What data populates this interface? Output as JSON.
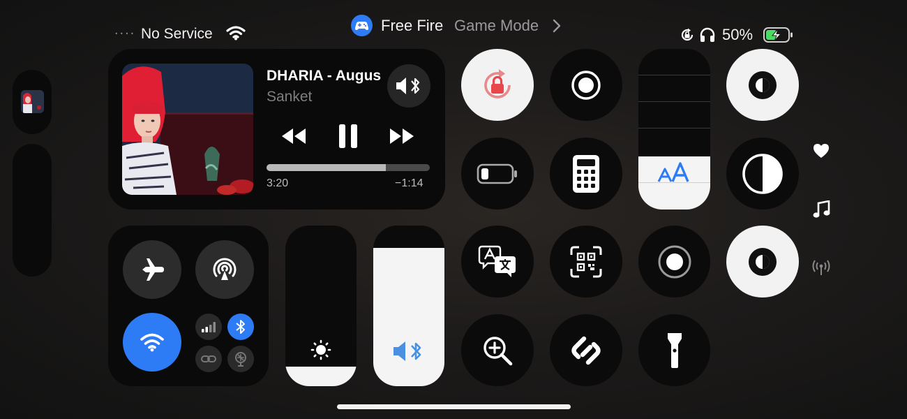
{
  "status_bar": {
    "signal_dots": "....",
    "carrier": "No Service",
    "battery_percent": "50%",
    "battery_level": 0.5,
    "icons": [
      "wifi-icon",
      "rotation-lock-icon",
      "headphones-icon",
      "battery-charging-icon"
    ]
  },
  "game_banner": {
    "app": "Free Fire",
    "mode": "Game Mode",
    "icons": [
      "gamepad-icon",
      "chevron-right-icon"
    ]
  },
  "now_playing": {
    "title": "DHARIA - Augus",
    "artist": "Sanket",
    "elapsed": "3:20",
    "remaining": "−1:14",
    "progress": 0.73,
    "icons": [
      "album-art",
      "speaker-bluetooth-icon",
      "rewind-icon",
      "pause-icon",
      "fast-forward-icon"
    ]
  },
  "connectivity": {
    "icons": [
      "airplane-icon",
      "airdrop-icon",
      "wifi-icon",
      "cellular-icon",
      "bluetooth-icon",
      "personal-hotspot-icon",
      "satellite-icon"
    ]
  },
  "sliders": {
    "brightness_level": 0.12,
    "volume_level": 0.86,
    "text_size_level": 0.33,
    "icons": [
      "brightness-icon",
      "speaker-bluetooth-icon",
      "text-size-icon"
    ]
  },
  "tiles": {
    "icons": [
      "orientation-lock-icon",
      "screen-record-icon",
      "dark-mode-icon",
      "low-power-icon",
      "calculator-icon",
      "contrast-icon",
      "translate-icon",
      "qr-scanner-icon",
      "record-icon",
      "color-filter-icon",
      "magnifier-icon",
      "shazam-icon",
      "flashlight-icon"
    ]
  },
  "side_icons": [
    "heart-icon",
    "music-note-icon",
    "antenna-icon"
  ],
  "accent_colors": {
    "blue": "#2d7cf6",
    "red": "#e8484c",
    "panel": "#0b0b0b",
    "light": "#f2f2f2"
  }
}
